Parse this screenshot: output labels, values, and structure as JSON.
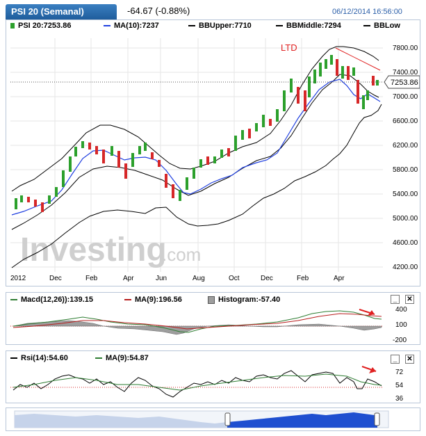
{
  "header": {
    "title": "PSI 20 (Semanal)",
    "change": "-64.67 (-0.88%)",
    "datetime": "06/12/2014 16:56:00"
  },
  "main_legend": {
    "price": "PSI 20:7253.86",
    "ma": "MA(10):7237",
    "bb_upper": "BBUpper:7710",
    "bb_middle": "BBMiddle:7294",
    "bb_lower": "BBLow"
  },
  "main_chart": {
    "annotation": "LTD",
    "watermark": "Investing",
    "watermark_suffix": ".com",
    "last_price_label": "7253.86",
    "x_labels": [
      "2012",
      "Dec",
      "Feb",
      "Apr",
      "Jun",
      "Aug",
      "Oct",
      "Dec",
      "Feb",
      "Apr"
    ],
    "y_labels": [
      "7800.00",
      "7400.00",
      "7000.00",
      "6600.00",
      "6200.00",
      "5800.00",
      "5400.00",
      "5000.00",
      "4600.00",
      "4200.00"
    ]
  },
  "macd_legend": {
    "macd": "Macd(12,26)):139.15",
    "ma": "MA(9):196.56",
    "hist": "Histogram:-57.40"
  },
  "macd_y_labels": [
    "400",
    "100",
    "-200"
  ],
  "rsi_legend": {
    "rsi": "Rsi(14):54.60",
    "ma": "MA(9):54.87"
  },
  "rsi_y_labels": [
    "72",
    "54",
    "36"
  ],
  "buttons": {
    "minimize": "_",
    "close": "✕"
  },
  "colors": {
    "up": "#2ca02c",
    "down": "#d62728",
    "ma_line": "#1f3fe0",
    "bb_line": "#000000",
    "macd_line": "#2e7d32",
    "macd_ma": "#b71c1c",
    "hist": "#9e9e9e",
    "rsi_line": "#000000",
    "rsi_ma": "#2e7d32",
    "arrow": "#e02020",
    "tab": "#2a6db3"
  },
  "chart_data": {
    "type": "candlestick",
    "x": [
      "2012-10",
      "2012-11",
      "2012-12",
      "2013-01",
      "2013-02",
      "2013-03",
      "2013-04",
      "2013-05",
      "2013-06",
      "2013-07",
      "2013-08",
      "2013-09",
      "2013-10",
      "2013-11",
      "2013-12",
      "2014-01",
      "2014-02",
      "2014-03",
      "2014-04",
      "2014-05",
      "2014-06"
    ],
    "close": [
      5300,
      5300,
      5500,
      6300,
      6000,
      6050,
      6000,
      5950,
      5300,
      5700,
      5900,
      6050,
      6400,
      6450,
      6600,
      7000,
      7500,
      7600,
      7300,
      6900,
      7253.86
    ],
    "ma10_last": 7237,
    "bb_upper_last": 7710,
    "bb_middle_last": 7294,
    "ylim": [
      4200,
      7900
    ]
  }
}
